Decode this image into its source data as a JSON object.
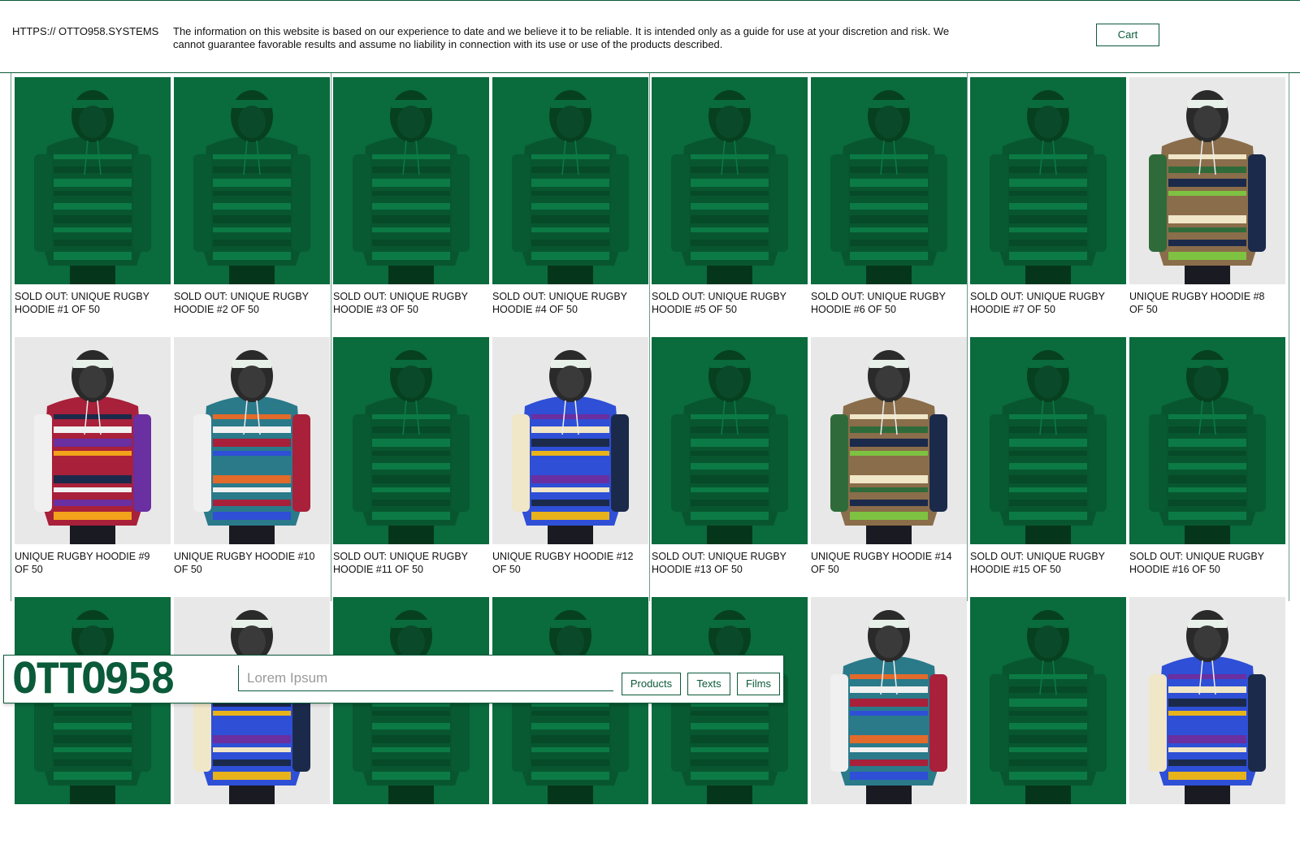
{
  "header": {
    "site_url": "HTTPS:// OTTO958.SYSTEMS",
    "disclaimer": "The information on this website is based on our experience to date and we believe it to be reliable. It is intended only as a guide for use at your discretion and risk. We cannot guarantee favorable results and assume no liability in connection with its use or use of the products described.",
    "cart_label": "Cart"
  },
  "products": [
    {
      "title": "SOLD OUT: UNIQUE RUGBY HOODIE #1 OF 50",
      "state": "sold-out"
    },
    {
      "title": "SOLD OUT: UNIQUE RUGBY HOODIE #2 OF 50",
      "state": "sold-out"
    },
    {
      "title": "SOLD OUT: UNIQUE RUGBY HOODIE #3 OF 50",
      "state": "sold-out"
    },
    {
      "title": "SOLD OUT: UNIQUE RUGBY HOODIE #4 OF 50",
      "state": "sold-out"
    },
    {
      "title": "SOLD OUT: UNIQUE RUGBY HOODIE #5 OF 50",
      "state": "sold-out"
    },
    {
      "title": "SOLD OUT: UNIQUE RUGBY HOODIE #6 OF 50",
      "state": "sold-out"
    },
    {
      "title": "SOLD OUT: UNIQUE RUGBY HOODIE #7 OF 50",
      "state": "sold-out"
    },
    {
      "title": "UNIQUE RUGBY HOODIE #8 OF 50",
      "state": "available"
    },
    {
      "title": "UNIQUE RUGBY HOODIE #9 OF 50",
      "state": "available"
    },
    {
      "title": "UNIQUE RUGBY HOODIE #10 OF 50",
      "state": "available"
    },
    {
      "title": "SOLD OUT: UNIQUE RUGBY HOODIE #11 OF 50",
      "state": "sold-out"
    },
    {
      "title": "UNIQUE RUGBY HOODIE #12 OF 50",
      "state": "available"
    },
    {
      "title": "SOLD OUT: UNIQUE RUGBY HOODIE #13 OF 50",
      "state": "sold-out"
    },
    {
      "title": "UNIQUE RUGBY HOODIE #14 OF 50",
      "state": "available"
    },
    {
      "title": "SOLD OUT: UNIQUE RUGBY HOODIE #15 OF 50",
      "state": "sold-out"
    },
    {
      "title": "SOLD OUT: UNIQUE RUGBY HOODIE #16 OF 50",
      "state": "sold-out"
    },
    {
      "title": "",
      "state": "sold-out"
    },
    {
      "title": "",
      "state": "available"
    },
    {
      "title": "",
      "state": "sold-out"
    },
    {
      "title": "",
      "state": "sold-out"
    },
    {
      "title": "",
      "state": "sold-out"
    },
    {
      "title": "",
      "state": "available"
    },
    {
      "title": "",
      "state": "sold-out"
    },
    {
      "title": "",
      "state": "available"
    }
  ],
  "footer_bar": {
    "logo_text": "OTTO958",
    "search_placeholder": "Lorem Ipsum",
    "nav": [
      "Products",
      "Texts",
      "Films"
    ]
  },
  "colors": {
    "brand_green": "#0b5a3a",
    "sold_out_overlay": "#0a6b3d",
    "photo_background": "#e8e8e8"
  }
}
